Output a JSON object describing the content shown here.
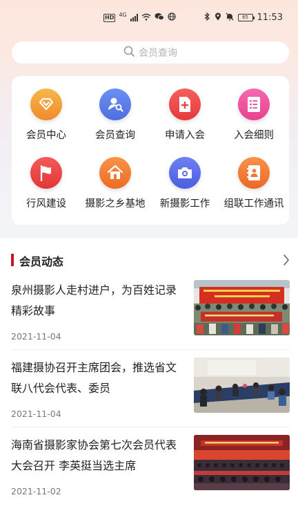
{
  "status_bar": {
    "left_badges": [
      "HD",
      "4G"
    ],
    "time": "11:53",
    "battery": "65"
  },
  "search": {
    "placeholder": "会员查询"
  },
  "quick_menu": [
    {
      "label": "会员中心",
      "icon": "heart-diamond-icon",
      "color": "#f3a43c"
    },
    {
      "label": "会员查询",
      "icon": "user-search-icon",
      "color": "#5b7de9"
    },
    {
      "label": "申请入会",
      "icon": "add-document-icon",
      "color": "#ef4a4a"
    },
    {
      "label": "入会细则",
      "icon": "list-icon",
      "color": "#ee4d9d"
    },
    {
      "label": "行风建设",
      "icon": "flag-icon",
      "color": "#ef4747"
    },
    {
      "label": "摄影之乡基地",
      "icon": "home-icon",
      "color": "#f47c33"
    },
    {
      "label": "新摄影工作",
      "icon": "camera-icon",
      "color": "#5a6eee"
    },
    {
      "label": "组联工作通讯",
      "icon": "contact-book-icon",
      "color": "#f37a3a"
    }
  ],
  "news_section": {
    "title": "会员动态",
    "items": [
      {
        "title": "泉州摄影人走村进户，为百姓记录精彩故事",
        "date": "2021-11-04"
      },
      {
        "title": "福建摄协召开主席团会，推选省文联八代会代表、委员",
        "date": "2021-11-04"
      },
      {
        "title": "海南省摄影家协会第七次会员代表大会召开 李英挺当选主席",
        "date": "2021-11-02"
      }
    ]
  }
}
